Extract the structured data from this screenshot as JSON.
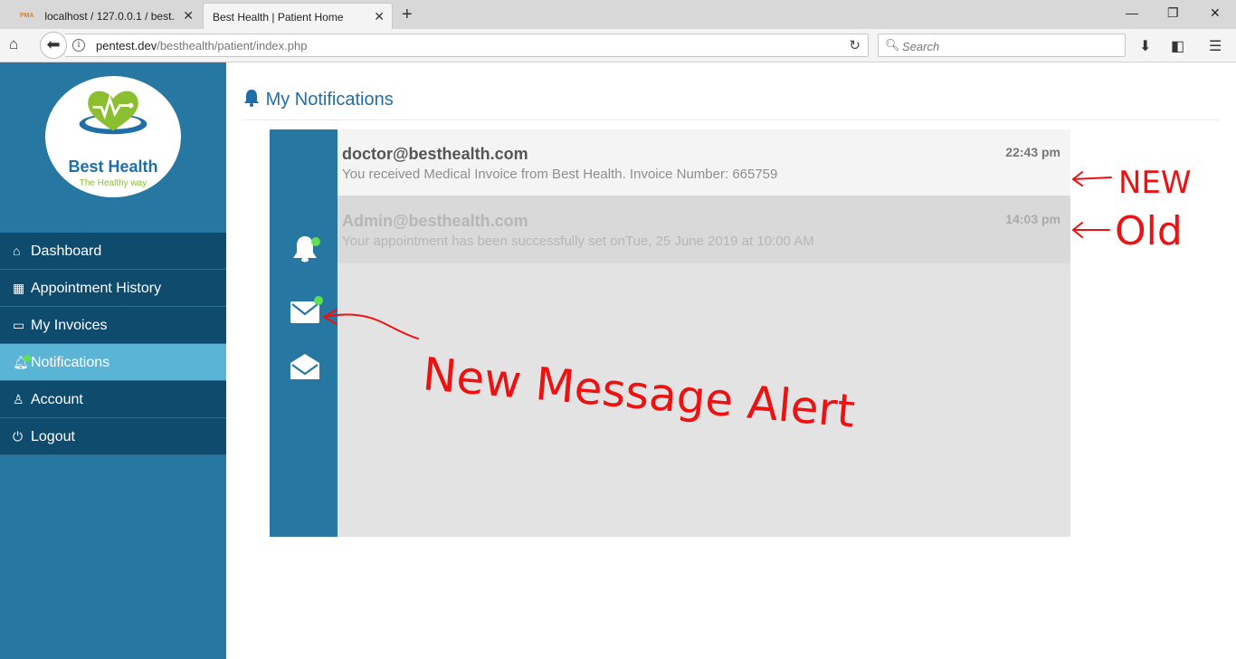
{
  "browser": {
    "tabs": [
      {
        "favicon": "PMA",
        "title": "localhost / 127.0.0.1 / best..."
      },
      {
        "title": "Best Health | Patient Home"
      }
    ],
    "url_host": "pentest.dev",
    "url_path": "/besthealth/patient/index.php",
    "search_placeholder": "Search",
    "icons": [
      "home-icon",
      "back-icon",
      "info-icon",
      "reload-icon",
      "search-icon",
      "download-icon",
      "sidebar-icon",
      "menu-icon",
      "minimize-icon",
      "restore-icon",
      "close-icon"
    ]
  },
  "logo": {
    "name": "Best Health",
    "tagline": "The Healthy way",
    "colors": {
      "green": "#8bbf30",
      "blue": "#1f6ea8"
    }
  },
  "sidebar": {
    "items": [
      {
        "icon": "home-icon",
        "label": "Dashboard",
        "active": false
      },
      {
        "icon": "calendar-icon",
        "label": "Appointment History",
        "active": false
      },
      {
        "icon": "credit-card-icon",
        "label": "My Invoices",
        "active": false
      },
      {
        "icon": "bell-icon",
        "label": "Notifications",
        "active": true,
        "badge_dot": true
      },
      {
        "icon": "user-icon",
        "label": "Account",
        "active": false
      },
      {
        "icon": "power-icon",
        "label": "Logout",
        "active": false
      }
    ]
  },
  "page": {
    "title": "My Notifications",
    "side_icons": [
      {
        "icon": "bell-icon",
        "badge_dot": true
      },
      {
        "icon": "envelope-icon",
        "badge_dot": true
      },
      {
        "icon": "envelope-open-icon",
        "badge_dot": false
      }
    ],
    "notifications": [
      {
        "sender": "doctor@besthealth.com",
        "message": "You received Medical Invoice from Best Health. Invoice Number: 665759",
        "time": "22:43 pm",
        "status": "new"
      },
      {
        "sender": "Admin@besthealth.com",
        "message": "Your appointment has been successfully set onTue, 25 June 2019 at 10:00 AM",
        "time": "14:03 pm",
        "status": "old"
      }
    ]
  },
  "annotations": {
    "new_label": "NEW",
    "old_label": "Old",
    "alert_label": "New Message Alert",
    "color": "#ee1111"
  },
  "colors": {
    "sidebar_bg": "#2677a1",
    "menu_bg": "#0e4b6d",
    "menu_active": "#5ab4d6",
    "badge_green": "#5fe04e"
  }
}
